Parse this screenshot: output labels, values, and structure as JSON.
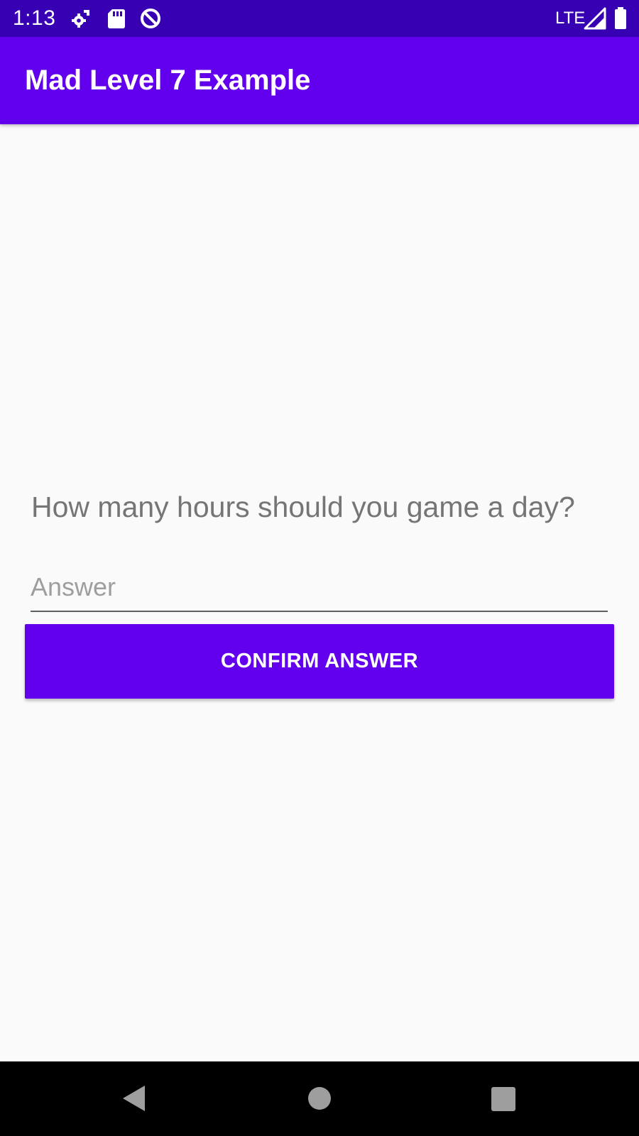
{
  "status_bar": {
    "time": "1:13",
    "network": "LTE",
    "icons": [
      "settings-icon",
      "sd-card-icon",
      "blocked-icon",
      "signal-icon",
      "battery-icon"
    ]
  },
  "app_bar": {
    "title": "Mad Level 7 Example"
  },
  "main": {
    "question": "How many hours should you game a day?",
    "answer_value": "",
    "answer_placeholder": "Answer",
    "confirm_label": "CONFIRM ANSWER"
  },
  "nav_bar": {
    "icons": [
      "back-icon",
      "home-icon",
      "recents-icon"
    ]
  },
  "colors": {
    "status_bar": "#3700b3",
    "primary": "#6200ee",
    "background": "#fafafa",
    "question_text": "#757575"
  }
}
